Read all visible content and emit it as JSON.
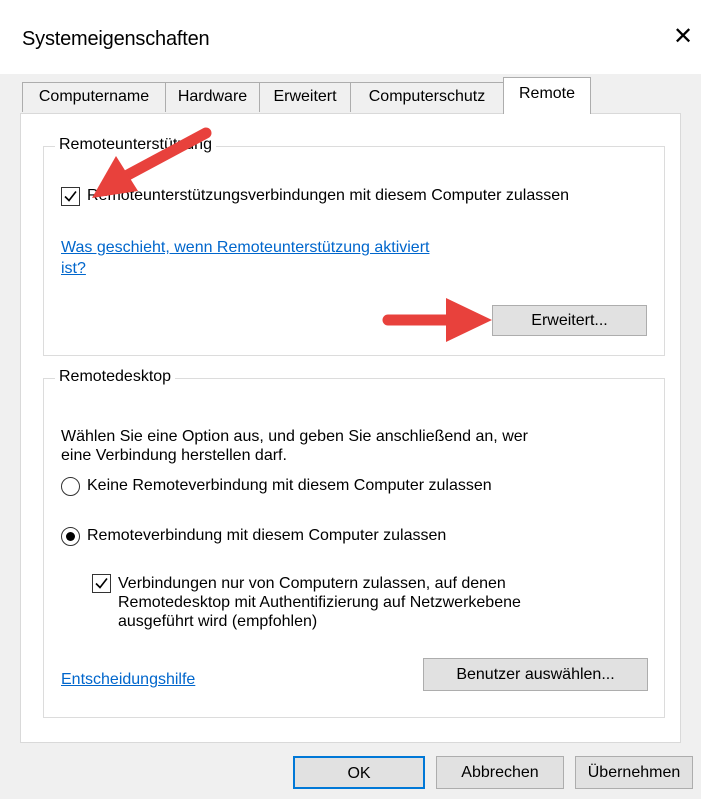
{
  "window": {
    "title": "Systemeigenschaften"
  },
  "tabs": [
    {
      "label": "Computername"
    },
    {
      "label": "Hardware"
    },
    {
      "label": "Erweitert"
    },
    {
      "label": "Computerschutz"
    },
    {
      "label": "Remote",
      "active": true
    }
  ],
  "remote_assistance": {
    "group_label": "Remoteunterstützung",
    "allow_label": "Remoteunterstützungsverbindungen mit diesem Computer zulassen",
    "allow_checked": true,
    "help_link_line1": "Was geschieht, wenn Remoteunterstützung aktiviert",
    "help_link_line2": "ist?",
    "advanced_button": "Erweitert..."
  },
  "remote_desktop": {
    "group_label": "Remotedesktop",
    "instruction_line1": "Wählen Sie eine Option aus, und geben Sie anschließend an, wer",
    "instruction_line2": "eine Verbindung herstellen darf.",
    "option_none": "Keine Remoteverbindung mit diesem Computer zulassen",
    "option_allow": "Remoteverbindung mit diesem Computer zulassen",
    "selected_option": "allow",
    "nla_line1": "Verbindungen nur von Computern zulassen, auf denen",
    "nla_line2": "Remotedesktop mit Authentifizierung auf Netzwerkebene",
    "nla_line3": "ausgeführt wird (empfohlen)",
    "nla_checked": true,
    "help_link": "Entscheidungshilfe",
    "select_users_button": "Benutzer auswählen..."
  },
  "footer": {
    "ok_label": "OK",
    "cancel_label": "Abbrechen",
    "apply_label": "Übernehmen"
  },
  "colors": {
    "link": "#0066cc",
    "annotation_arrow": "#e8413c"
  },
  "icons": {
    "close": "close-icon",
    "arrow": "annotation-arrow-icon"
  }
}
